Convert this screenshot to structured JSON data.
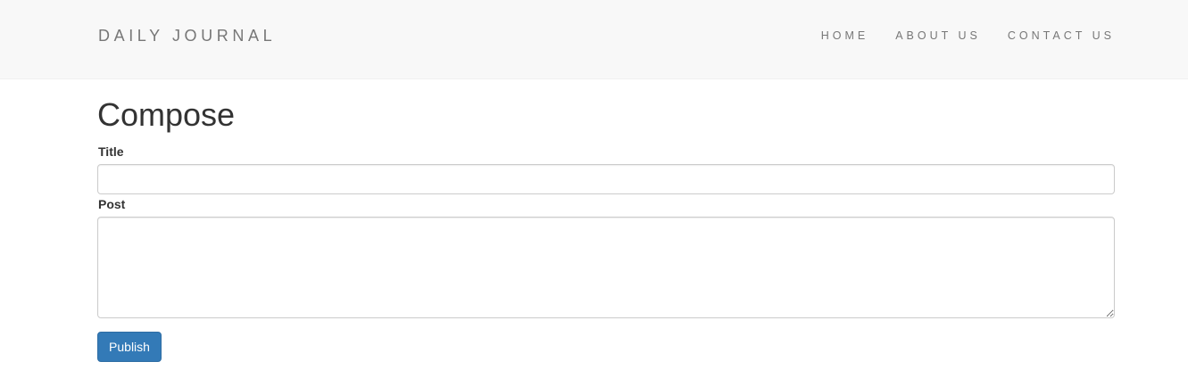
{
  "navbar": {
    "brand": "DAILY JOURNAL",
    "links": [
      "HOME",
      "ABOUT US",
      "CONTACT US"
    ]
  },
  "main": {
    "heading": "Compose",
    "form": {
      "title_label": "Title",
      "title_value": "",
      "post_label": "Post",
      "post_value": "",
      "submit_label": "Publish"
    }
  },
  "colors": {
    "navbar_bg": "#f8f8f8",
    "nav_text": "#777777",
    "button_primary": "#337ab7"
  }
}
